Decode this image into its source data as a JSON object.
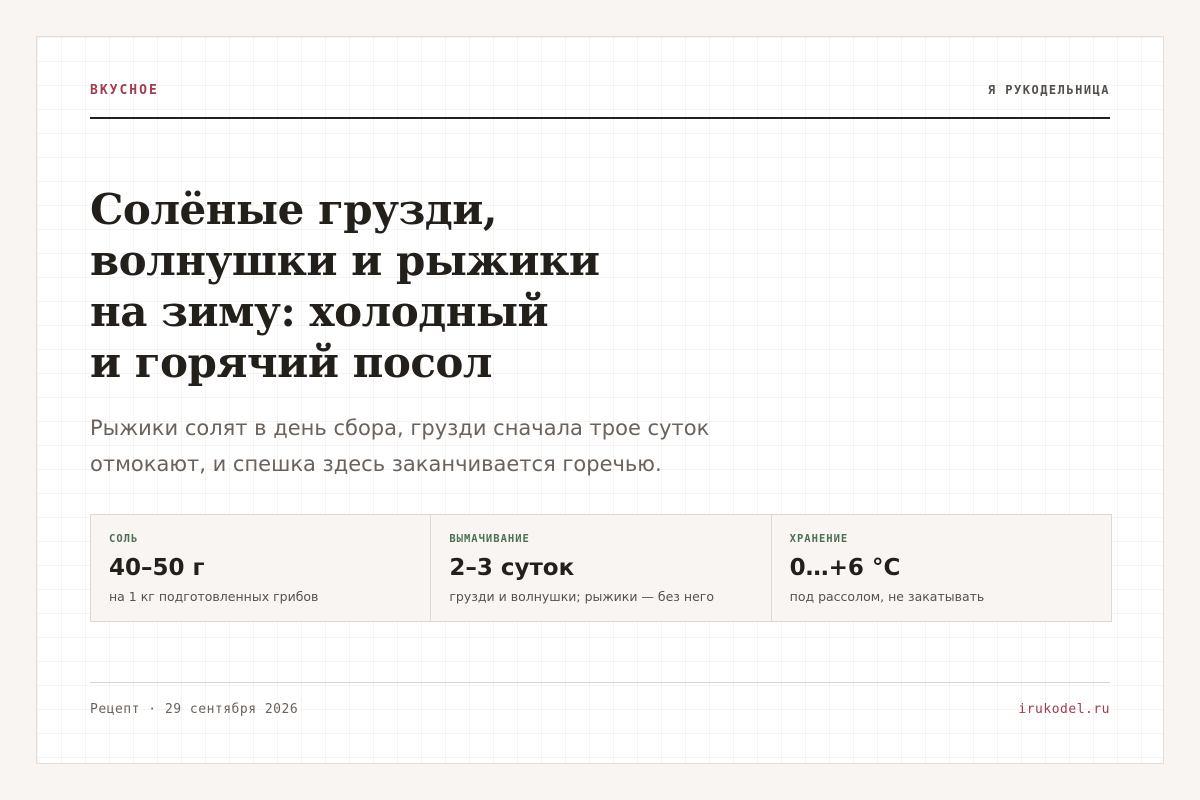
{
  "header": {
    "kicker": "ВКУСНОЕ",
    "site_name": "Я РУКОДЕЛЬНИЦА"
  },
  "article": {
    "title_lines": [
      "Солёные грузди,",
      "волнушки и рыжики",
      "на зиму: холодный",
      "и горячий посол"
    ],
    "lead": "Рыжики солят в день сбора, грузди сначала трое суток отмокают, и спешка здесь заканчивается горечью."
  },
  "stats": [
    {
      "label": "СОЛЬ",
      "value": "40–50 г",
      "note": "на 1 кг подготовленных грибов"
    },
    {
      "label": "ВЫМАЧИВАНИЕ",
      "value": "2–3 суток",
      "note": "грузди и волнушки; рыжики — без него"
    },
    {
      "label": "ХРАНЕНИЕ",
      "value": "0…+6 °C",
      "note": "под рассолом, не закатывать"
    }
  ],
  "footer": {
    "meta": "Рецепт · 29 сентября 2026",
    "domain": "irukodel.ru"
  },
  "colors": {
    "accent": "#a23b4e",
    "label_green": "#4e6e56",
    "text": "#231f1b",
    "page_bg": "#f9f5f2"
  }
}
